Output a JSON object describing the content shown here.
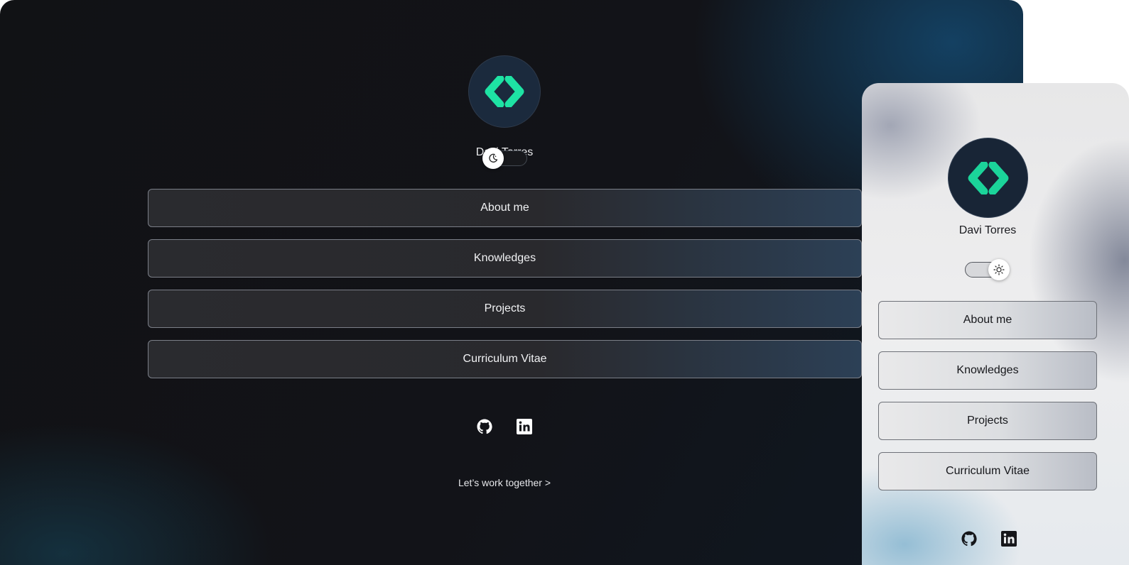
{
  "profile": {
    "name": "Davi Torres",
    "logo_icon": "code-brackets-logo"
  },
  "menu": {
    "items": [
      {
        "label": "About me"
      },
      {
        "label": "Knowledges"
      },
      {
        "label": "Projects"
      },
      {
        "label": "Curriculum Vitae"
      }
    ]
  },
  "social": {
    "icons": [
      "github-icon",
      "linkedin-icon"
    ]
  },
  "cta": {
    "label": "Let’s work together >"
  },
  "theme_toggle": {
    "dark_icon": "moon-icon",
    "light_icon": "sun-icon"
  },
  "colors": {
    "accent": "#1ee3a4",
    "avatar_bg": "#1b2a3d"
  }
}
